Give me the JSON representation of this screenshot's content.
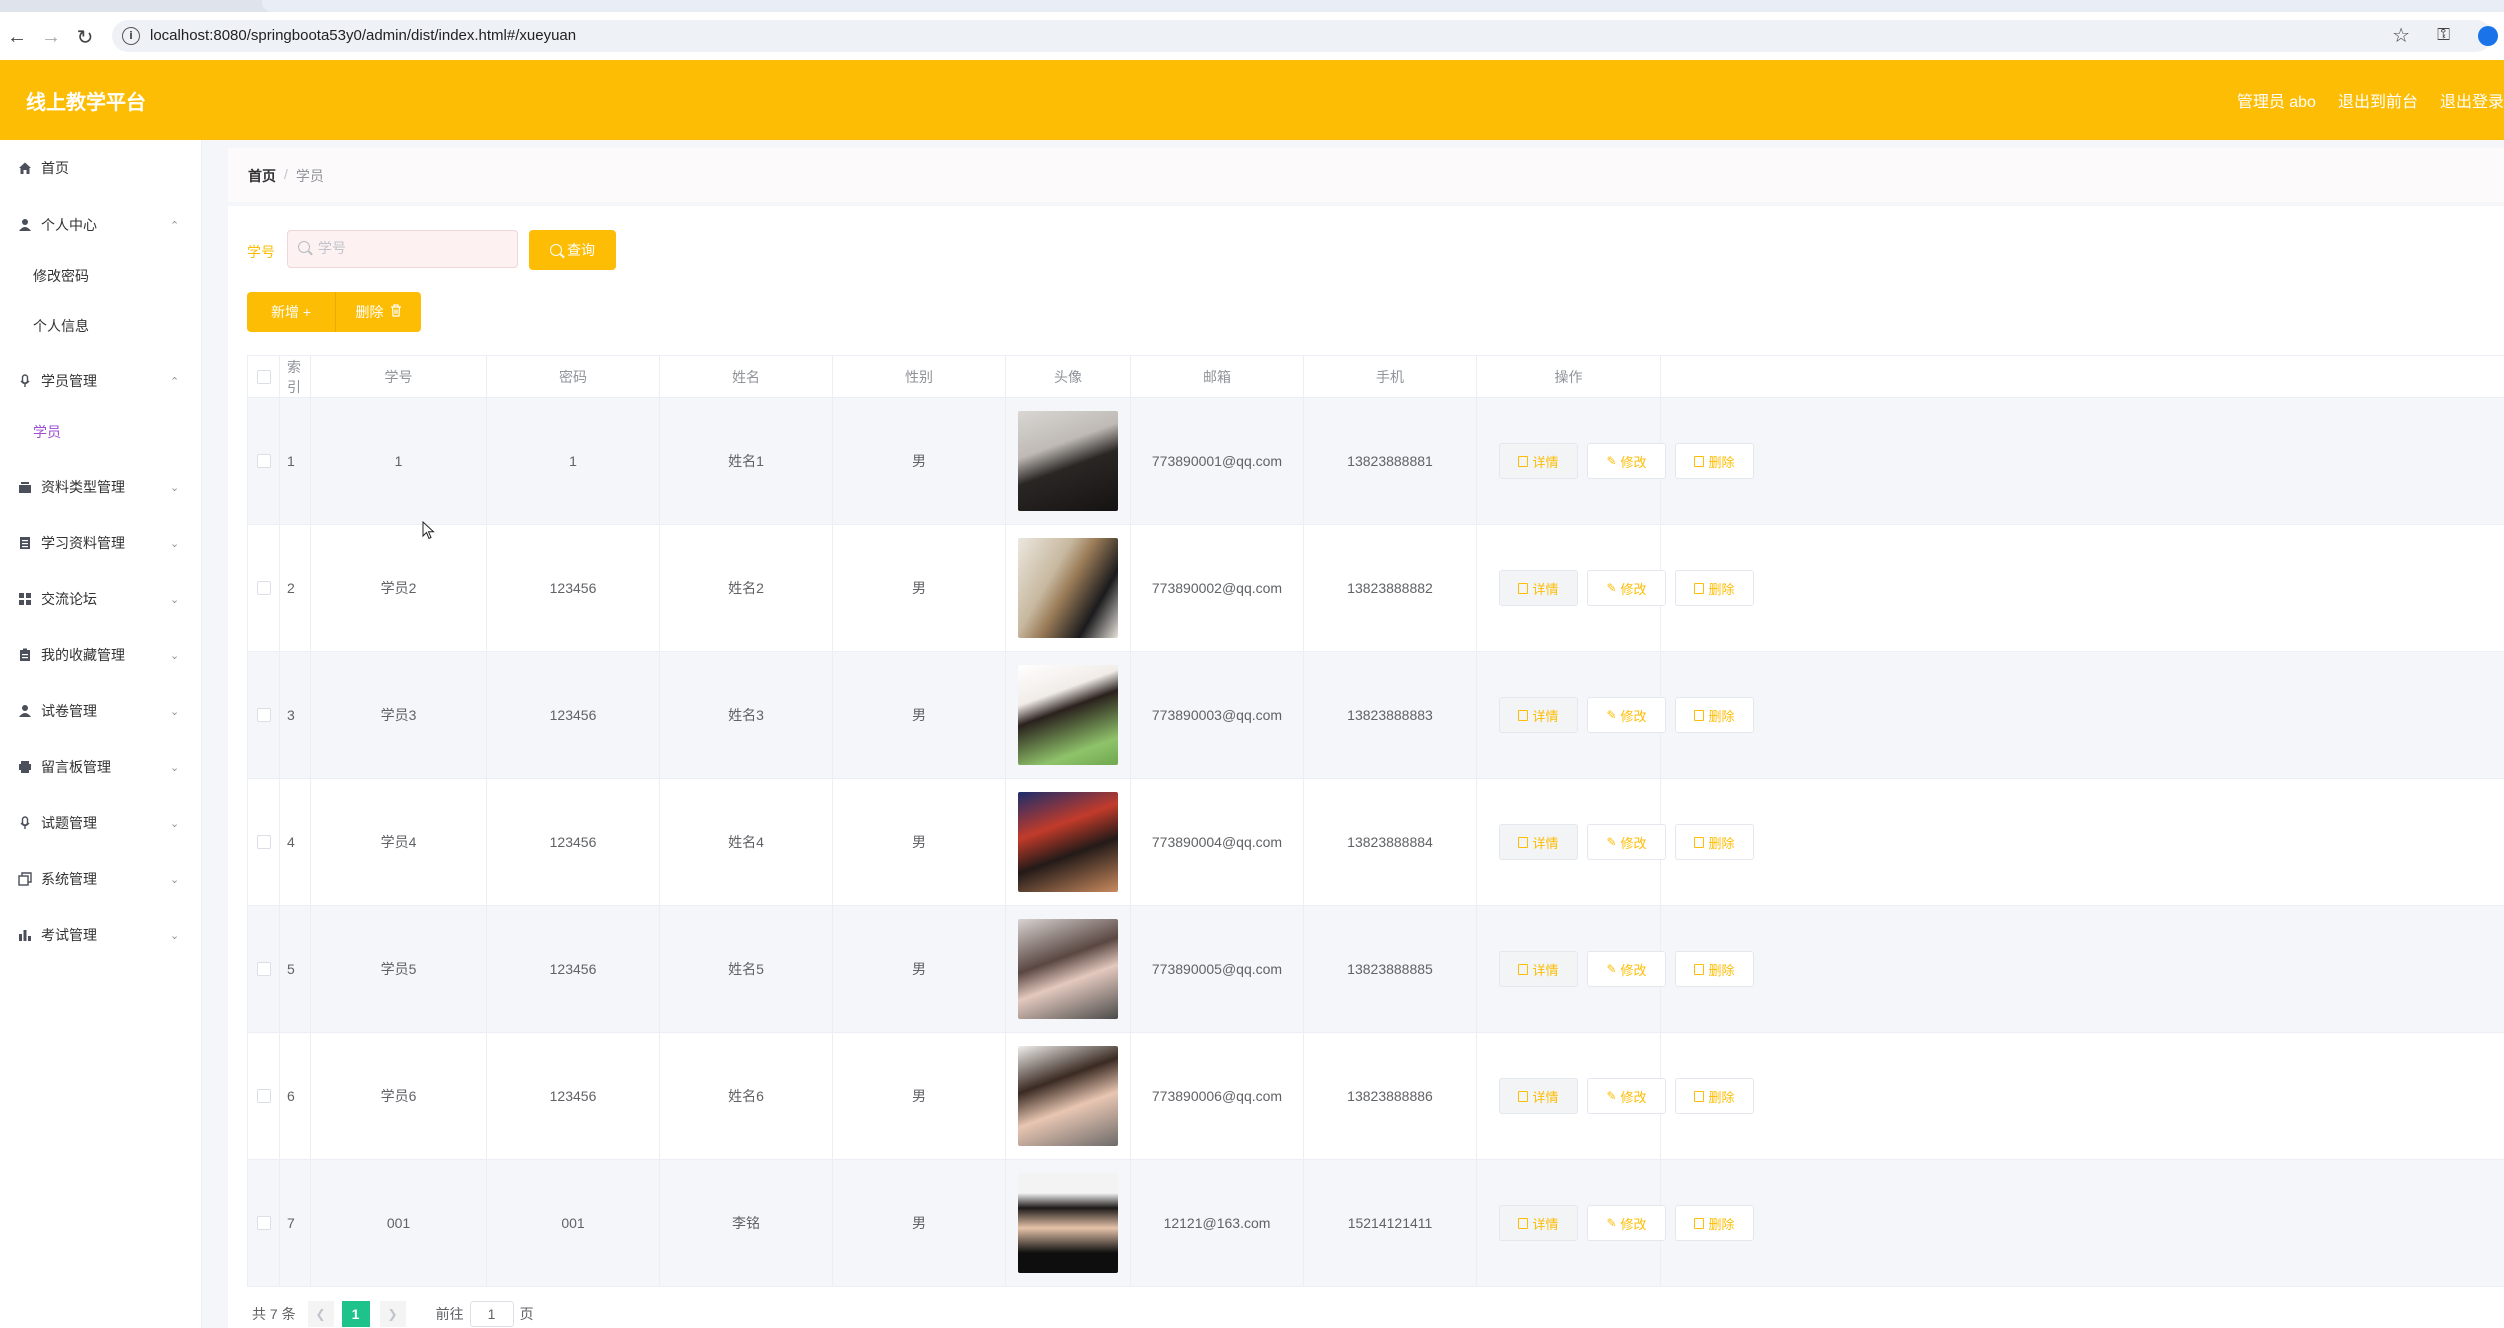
{
  "browser": {
    "url": "localhost:8080/springboota53y0/admin/dist/index.html#/xueyuan"
  },
  "header": {
    "title": "线上教学平台",
    "admin_label": "管理员 abo",
    "to_frontend": "退出到前台",
    "logout": "退出登录"
  },
  "sidebar": {
    "items": [
      {
        "label": "首页",
        "icon": "home-icon"
      },
      {
        "label": "个人中心",
        "icon": "user-icon",
        "expanded": true
      },
      {
        "label": "修改密码",
        "sub": true
      },
      {
        "label": "个人信息",
        "sub": true
      },
      {
        "label": "学员管理",
        "icon": "mic-icon",
        "expanded": true
      },
      {
        "label": "学员",
        "sub": true,
        "active": true
      },
      {
        "label": "资料类型管理",
        "icon": "stack-icon"
      },
      {
        "label": "学习资料管理",
        "icon": "list-icon"
      },
      {
        "label": "交流论坛",
        "icon": "grid-icon"
      },
      {
        "label": "我的收藏管理",
        "icon": "clipboard-icon"
      },
      {
        "label": "试卷管理",
        "icon": "user-icon"
      },
      {
        "label": "留言板管理",
        "icon": "printer-icon"
      },
      {
        "label": "试题管理",
        "icon": "mic-icon"
      },
      {
        "label": "系统管理",
        "icon": "copy-icon"
      },
      {
        "label": "考试管理",
        "icon": "bar-chart-icon"
      }
    ]
  },
  "breadcrumb": {
    "home": "首页",
    "separator": "/",
    "current": "学员"
  },
  "search": {
    "label": "学号",
    "placeholder": "学号",
    "query_button": "查询"
  },
  "toolbar": {
    "add_label": "新增 +",
    "delete_label": "删除"
  },
  "table": {
    "columns": [
      "索引",
      "学号",
      "密码",
      "姓名",
      "性别",
      "头像",
      "邮箱",
      "手机",
      "操作"
    ],
    "rows": [
      {
        "index": "1",
        "xuehao": "1",
        "mima": "1",
        "xingming": "姓名1",
        "xingbie": "男",
        "youxiang": "773890001@qq.com",
        "shouji": "13823888881"
      },
      {
        "index": "2",
        "xuehao": "学员2",
        "mima": "123456",
        "xingming": "姓名2",
        "xingbie": "男",
        "youxiang": "773890002@qq.com",
        "shouji": "13823888882"
      },
      {
        "index": "3",
        "xuehao": "学员3",
        "mima": "123456",
        "xingming": "姓名3",
        "xingbie": "男",
        "youxiang": "773890003@qq.com",
        "shouji": "13823888883"
      },
      {
        "index": "4",
        "xuehao": "学员4",
        "mima": "123456",
        "xingming": "姓名4",
        "xingbie": "男",
        "youxiang": "773890004@qq.com",
        "shouji": "13823888884"
      },
      {
        "index": "5",
        "xuehao": "学员5",
        "mima": "123456",
        "xingming": "姓名5",
        "xingbie": "男",
        "youxiang": "773890005@qq.com",
        "shouji": "13823888885"
      },
      {
        "index": "6",
        "xuehao": "学员6",
        "mima": "123456",
        "xingming": "姓名6",
        "xingbie": "男",
        "youxiang": "773890006@qq.com",
        "shouji": "13823888886"
      },
      {
        "index": "7",
        "xuehao": "001",
        "mima": "001",
        "xingming": "李铭",
        "xingbie": "男",
        "youxiang": "12121@163.com",
        "shouji": "15214121411"
      }
    ],
    "actions": {
      "detail": "详情",
      "edit": "修改",
      "delete": "删除"
    }
  },
  "pagination": {
    "total": "共 7 条",
    "current_page": "1",
    "goto_prefix": "前往",
    "goto_value": "1",
    "goto_suffix": "页"
  },
  "colors": {
    "accent": "#fdbd04",
    "active_menu": "#9c4fd3",
    "page_active": "#1ec28b"
  }
}
